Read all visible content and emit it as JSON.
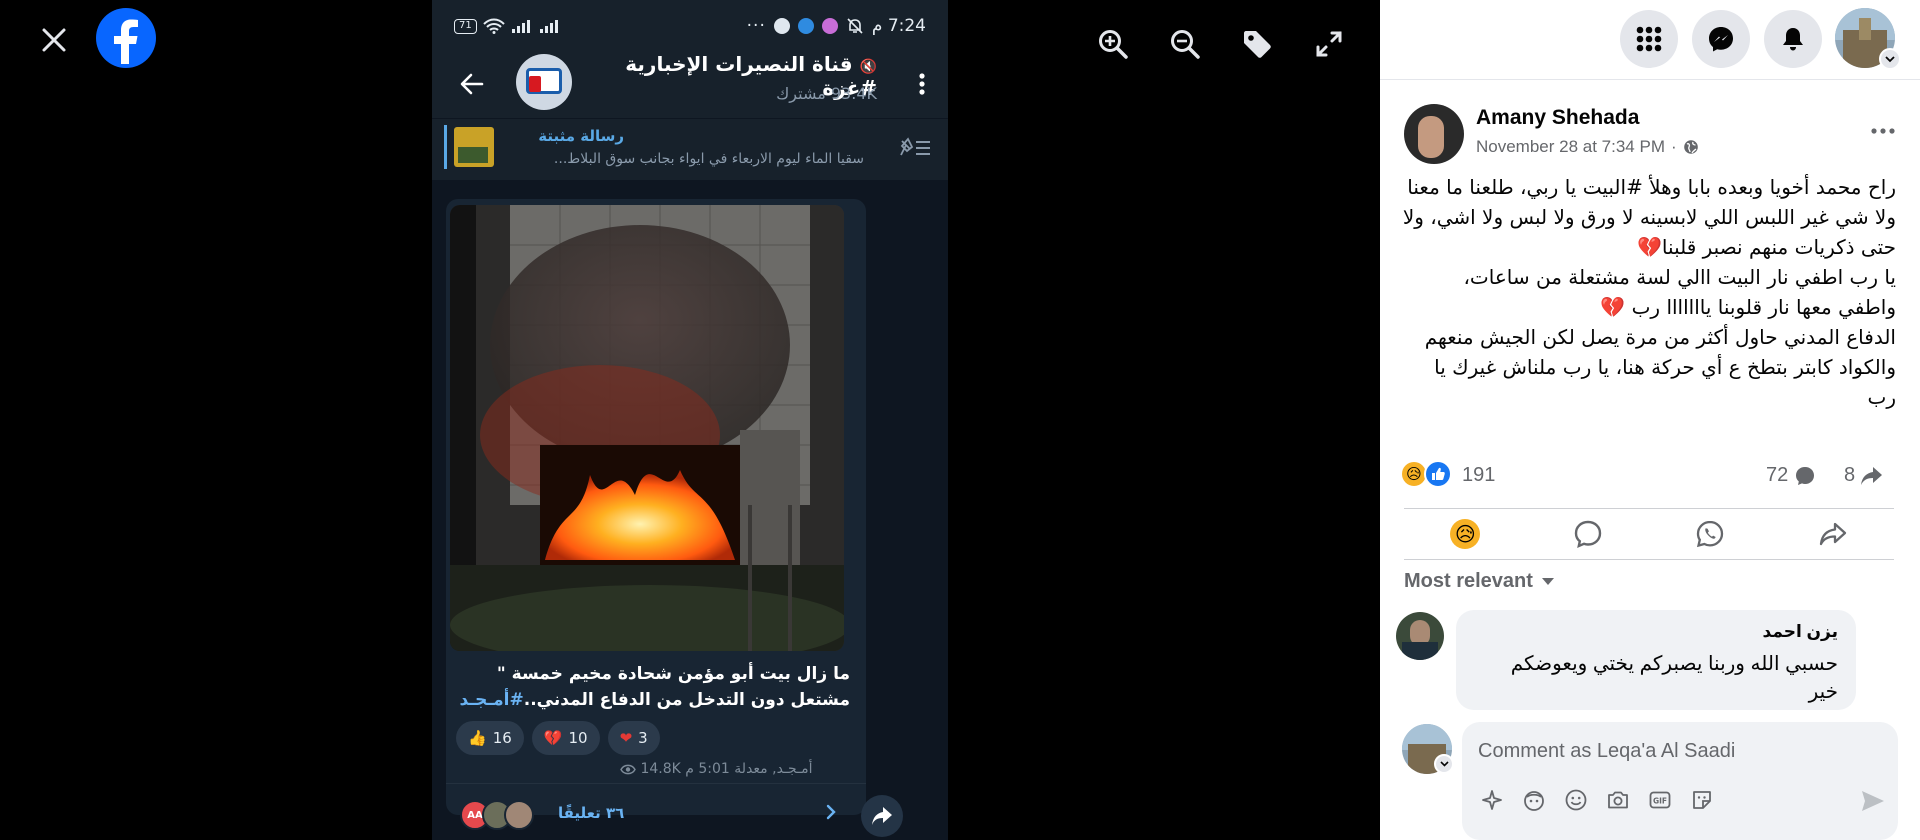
{
  "viewer": {
    "close_icon": "close-icon",
    "logo_icon": "facebook-logo-icon",
    "tools": [
      "zoom-in-icon",
      "zoom-out-icon",
      "tag-icon",
      "fullscreen-icon"
    ]
  },
  "phone": {
    "status": {
      "battery": "71",
      "time": "7:24 م"
    },
    "channel": {
      "title": "قناة النصيرات الإخبارية #غزة",
      "subscribers": "93.4K مشترك"
    },
    "pinned": {
      "label": "رسالة مثبتة",
      "text": "سقيا الماء ليوم الاربعاء في ايواء بجانب سوق البلاط..."
    },
    "message": {
      "text_line1": "ما زال بيت أبو مؤمن شحادة مخيم خمسة \"",
      "text_line2": "مشتعل دون التدخل من الدفاع المدني..",
      "hashtag": "#أمـجـد",
      "reactions": [
        {
          "emoji": "👍",
          "count": "16"
        },
        {
          "emoji": "💔",
          "count": "10"
        },
        {
          "emoji": "❤",
          "count": "3"
        }
      ],
      "meta_author": "أمـجـد, معدلة 5:01 م",
      "views": "14.8K",
      "comment_avatar_initials": "AA",
      "comments": "٣٦ تعليقًا"
    }
  },
  "panel": {
    "post": {
      "author": "Amany Shehada",
      "date": "November 28 at 7:34 PM",
      "privacy_separator": "·",
      "body": [
        "راح محمد أخويا وبعده بابا وهلأ #البيت يا ربي، طلعنا ما معنا ولا شي غير اللبس اللي لابسينه لا ورق ولا لبس ولا اشي، ولا حتى ذكريات منهم نصبر قلبنا💔",
        "يا رب اطفي نار البيت االي لسة مشتعلة من ساعات، واطفي معها نار قلوبنا يااااااا رب 💔",
        "الدفاع المدني حاول أكثر من مرة يصل لكن الجيش منعهم والكواد كابتر بتطخ ع أي حركة هنا، يا رب ملناش غيرك يا رب"
      ],
      "reaction_count": "191",
      "comment_count": "72",
      "share_count": "8"
    },
    "sort_label": "Most relevant",
    "comment": {
      "name": "يزن احمد",
      "text": "حسبي الله وربنا يصبركم يختي ويعوضكم خير"
    },
    "composer": {
      "placeholder": "Comment as Leqa'a Al Saadi"
    },
    "colors": {
      "brand": "#0866ff",
      "like": "#1877f2",
      "sad": "#f7b125"
    }
  }
}
